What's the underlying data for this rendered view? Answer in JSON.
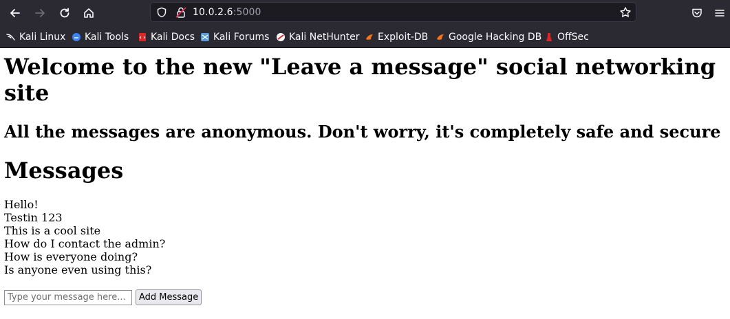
{
  "browser": {
    "url_host": "10.0.2.6",
    "url_port": ":5000",
    "bookmarks": [
      {
        "label": "Kali Linux",
        "icon": "kali-dragon-icon"
      },
      {
        "label": "Kali Tools",
        "icon": "kali-tools-icon"
      },
      {
        "label": "Kali Docs",
        "icon": "kali-docs-icon"
      },
      {
        "label": "Kali Forums",
        "icon": "kali-forums-icon"
      },
      {
        "label": "Kali NetHunter",
        "icon": "nethunter-icon"
      },
      {
        "label": "Exploit-DB",
        "icon": "exploit-db-icon"
      },
      {
        "label": "Google Hacking DB",
        "icon": "ghdb-icon"
      },
      {
        "label": "OffSec",
        "icon": "offsec-icon"
      }
    ]
  },
  "page": {
    "title": "Welcome to the new \"Leave a message\" social networking site",
    "subtitle": "All the messages are anonymous. Don't worry, it's completely safe and secure",
    "messages_heading": "Messages",
    "messages": [
      "Hello!",
      "Testin 123",
      "This is a cool site",
      "How do I contact the admin?",
      "How is everyone doing?",
      "Is anyone even using this?"
    ],
    "input_placeholder": "Type your message here...",
    "add_button_label": "Add Message"
  }
}
